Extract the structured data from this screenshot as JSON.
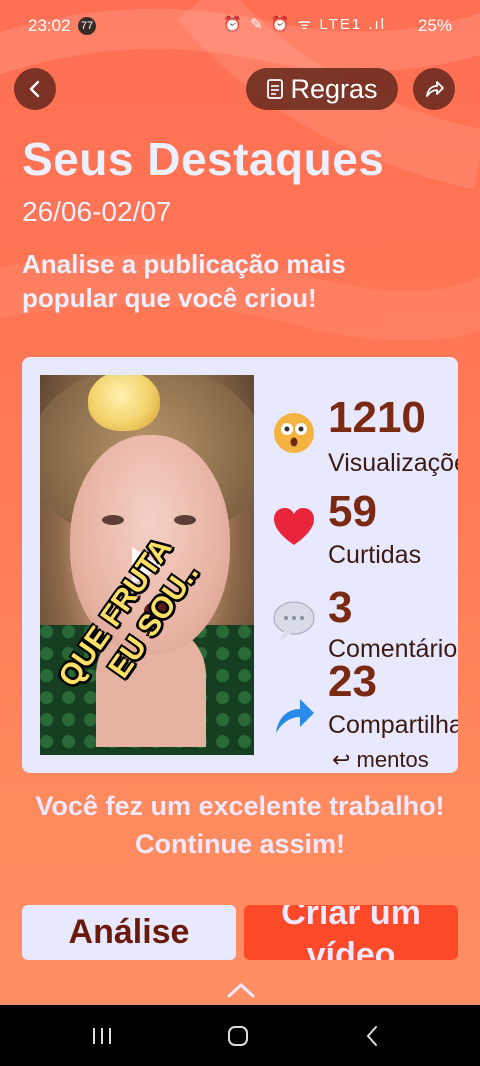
{
  "status_bar": {
    "time": "23:02",
    "notification_badge": "77",
    "icons_text": "⏰ ✎ ⏰ ᯤ LTE1 .ıl",
    "battery": "25%"
  },
  "header": {
    "back_icon": "back-arrow-icon",
    "rules_label": "Regras",
    "share_icon": "share-icon"
  },
  "main": {
    "title": "Seus Destaques",
    "dates": "26/06-02/07",
    "description": "Analise a publicação mais popular que você criou!"
  },
  "card": {
    "sticker_line1": "QUE FRUTA",
    "sticker_line2": "EU SOU..",
    "stats": [
      {
        "icon": "surprised-face-icon",
        "value": "1210",
        "label": "Visualizações"
      },
      {
        "icon": "heart-icon",
        "value": "59",
        "label": "Curtidas"
      },
      {
        "icon": "speech-bubble-icon",
        "value": "3",
        "label": "Comentários"
      },
      {
        "icon": "share-arrow-icon",
        "value": "23",
        "label": "Compartilha",
        "label2": "↩ mentos"
      }
    ]
  },
  "praise": "Você fez um excelente trabalho! Continue assim!",
  "buttons": {
    "analise": "Análise",
    "criar_line1": "Criar um",
    "criar_line2": "vídeo"
  },
  "colors": {
    "background": "#ff7a55",
    "primary_button": "#ff4a2a",
    "card": "#e8e8ff",
    "stat_value": "#7a2a12"
  }
}
